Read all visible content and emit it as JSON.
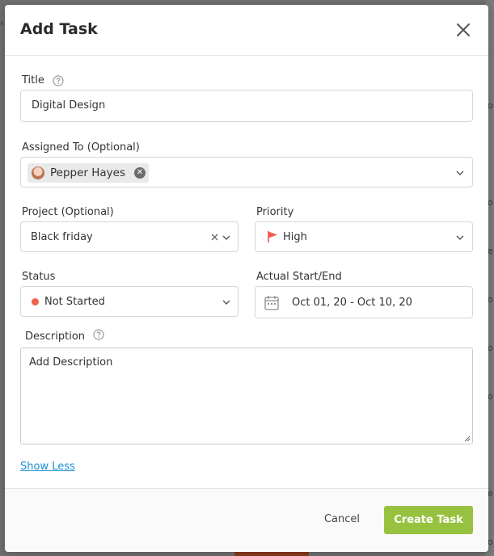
{
  "header": {
    "title": "Add Task"
  },
  "title_field": {
    "label": "Title",
    "value": "Digital Design"
  },
  "assigned_field": {
    "label": "Assigned To (Optional)",
    "assignee": "Pepper Hayes"
  },
  "project_field": {
    "label": "Project (Optional)",
    "value": "Black friday"
  },
  "priority_field": {
    "label": "Priority",
    "value": "High",
    "flag_color": "#f05a4f"
  },
  "status_field": {
    "label": "Status",
    "value": "Not Started",
    "dot_color": "#f0614b"
  },
  "dates_field": {
    "label": "Actual Start/End",
    "value": "Oct 01, 20 - Oct 10, 20"
  },
  "description_field": {
    "label": "Description",
    "placeholder": "Add Description"
  },
  "show_less": "Show Less",
  "footer": {
    "cancel": "Cancel",
    "create": "Create Task",
    "create_color": "#97c23f"
  },
  "background": {
    "right_edge_chars": [
      "o",
      "o",
      "e",
      "o",
      "o",
      "o",
      "e",
      "o",
      "o",
      "e"
    ]
  }
}
